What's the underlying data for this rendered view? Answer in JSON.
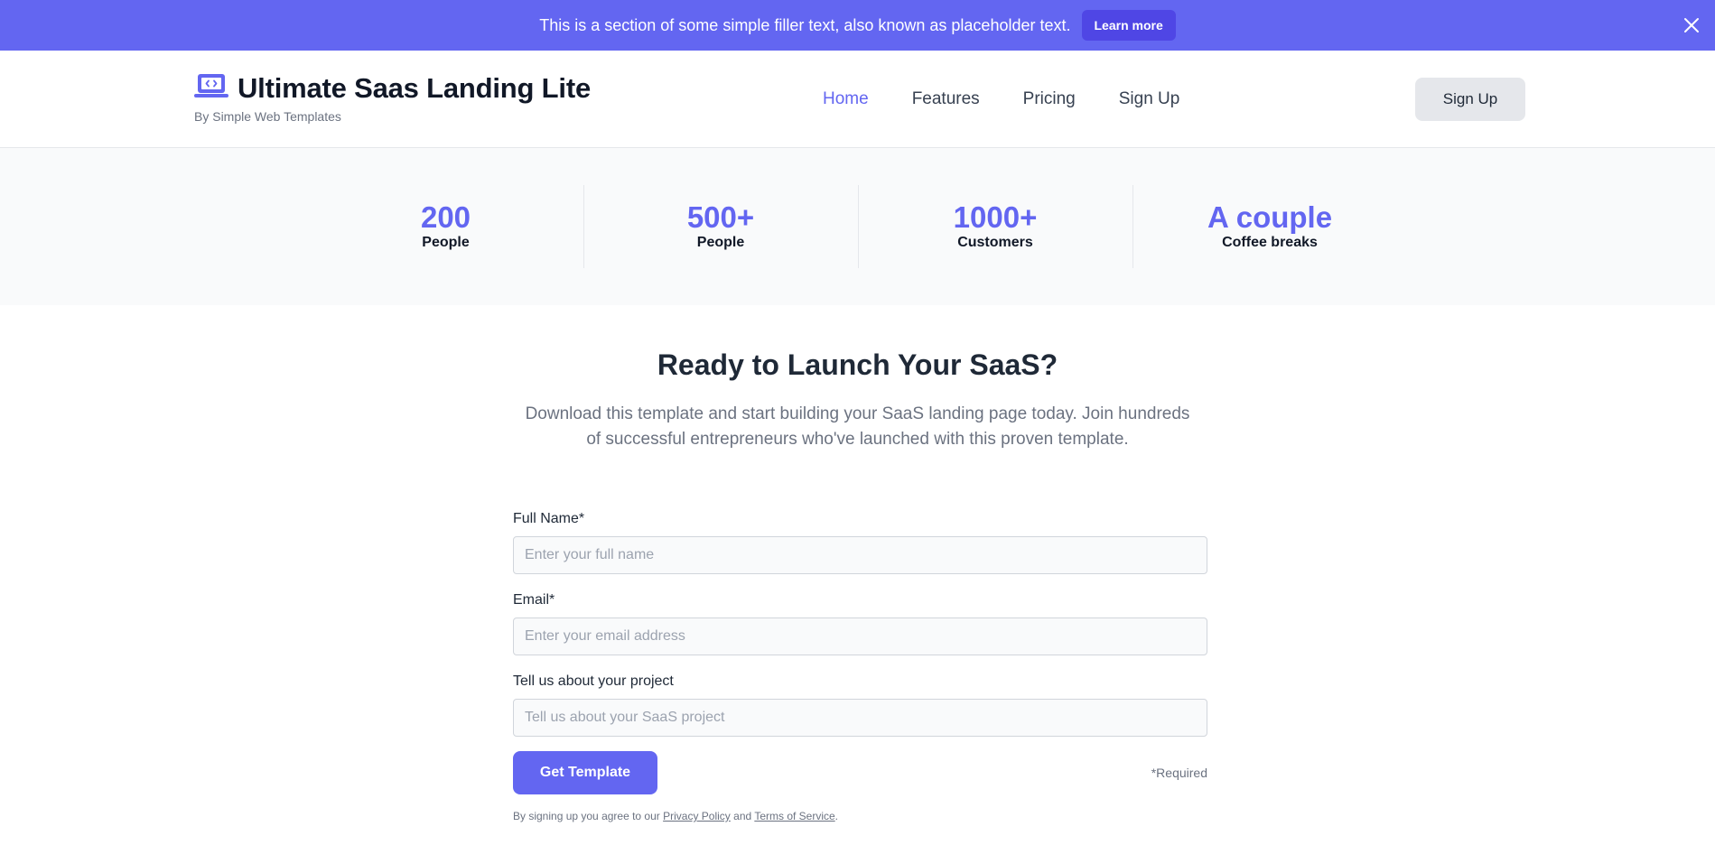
{
  "banner": {
    "text": "This is a section of some simple filler text, also known as placeholder text.",
    "button_label": "Learn more",
    "close_icon": "close-icon",
    "background": "#6366f1"
  },
  "header": {
    "brand_icon": "laptop-code-icon",
    "title": "Ultimate Saas Landing Lite",
    "subtitle": "By Simple Web Templates",
    "nav": [
      {
        "label": "Home",
        "active": true
      },
      {
        "label": "Features",
        "active": false
      },
      {
        "label": "Pricing",
        "active": false
      },
      {
        "label": "Sign Up",
        "active": false
      }
    ],
    "button_label": "Sign Up"
  },
  "stats": [
    {
      "value": "200",
      "label": "People"
    },
    {
      "value": "500+",
      "label": "People"
    },
    {
      "value": "1000+",
      "label": "Customers"
    },
    {
      "value": "A couple",
      "label": "Coffee breaks"
    }
  ],
  "cta": {
    "title": "Ready to Launch Your SaaS?",
    "description": "Download this template and start building your SaaS landing page today. Join hundreds of successful entrepreneurs who've launched with this proven template."
  },
  "form": {
    "fields": [
      {
        "label": "Full Name*",
        "placeholder": "Enter your full name",
        "value": ""
      },
      {
        "label": "Email*",
        "placeholder": "Enter your email address",
        "value": ""
      },
      {
        "label": "Tell us about your project",
        "placeholder": "Tell us about your SaaS project",
        "value": ""
      }
    ],
    "submit_label": "Get Template",
    "required_note": "*Required",
    "legal_prefix": "By signing up you agree to our",
    "privacy_link": "Privacy Policy",
    "legal_and": "and",
    "terms_link": "Terms of Service",
    "legal_suffix": "."
  },
  "colors": {
    "accent": "#6366f1",
    "accent_dark": "#4f46e5"
  }
}
